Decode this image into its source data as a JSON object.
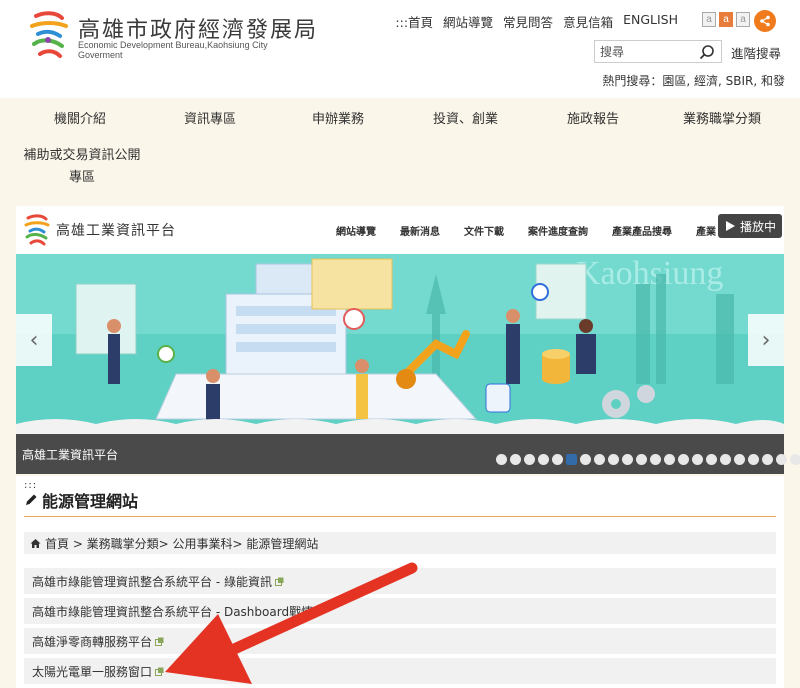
{
  "header": {
    "title": "高雄市政府經濟發展局",
    "subtitle": "Economic Development Bureau,Kaohsiung City Goverment",
    "top_links": [
      ":::首頁",
      "網站導覽",
      "常見問答",
      "意見信箱",
      "ENGLISH"
    ],
    "font_sizes": [
      "a",
      "a",
      "a"
    ],
    "search_placeholder": "搜尋",
    "advanced_search": "進階搜尋",
    "hot_search": "熱門搜尋：園區, 經濟, SBIR, 和發"
  },
  "main_nav": [
    "機關介紹",
    "資訊專區",
    "申辦業務",
    "投資、創業",
    "施政報告",
    "業務職掌分類",
    "補助或交易資訊公開專區"
  ],
  "banner": {
    "title": "高雄工業資訊平台",
    "nav_links": [
      "網站導覽",
      "最新消息",
      "文件下載",
      "案件進度查詢",
      "產業產品搜尋",
      "產業"
    ],
    "play_label": "播放中",
    "watermark": "Kaohsiung",
    "caption": "高雄工業資訊平台",
    "slide_count": 22,
    "active_slide": 6,
    "prev_glyph": "‹",
    "next_glyph": "›"
  },
  "content": {
    "mark": ":::",
    "page_title": "能源管理網站",
    "breadcrumb": "首頁 > 業務職掌分類> 公用事業科> 能源管理網站",
    "links": [
      "高雄市綠能管理資訊整合系統平台 - 綠能資訊",
      "高雄市綠能管理資訊整合系統平台 - Dashboard戰情",
      "高雄淨零商轉服務平台",
      "太陽光電單一服務窗口"
    ]
  },
  "colors": {
    "accent_orange": "#ef7b1d",
    "annotation_red": "#e53323",
    "caption_bar": "#4a4a4a",
    "active_dot": "#336aa8"
  }
}
